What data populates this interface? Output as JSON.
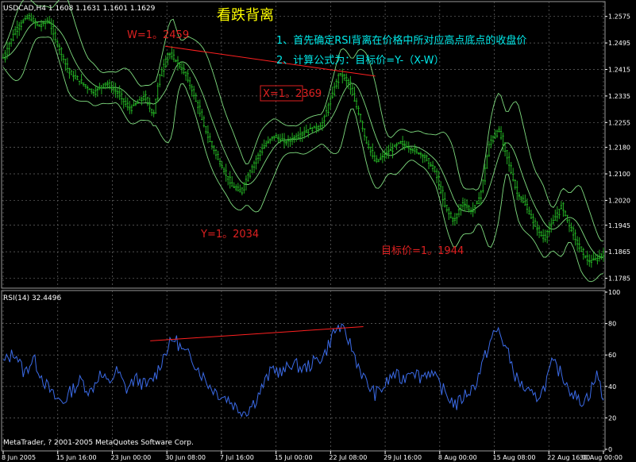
{
  "header": {
    "symbol_info": "USDCAD,H4  1.1608 1.1631 1.1601 1.1629",
    "title": "看跌背离"
  },
  "annotations": {
    "note1": "1、首先确定RSI背离在价格中所对应高点底点的收盘价",
    "note2": "2、计算公式为：目标价=Y-（X-W）",
    "w_label": "W=1。2459",
    "x_label": "X=1。2369",
    "y_label": "Y=1。2034",
    "target_label": "目标价=1。1944"
  },
  "rsi_panel": {
    "label": "RSI(14) 32.4496",
    "copyright": "MetaTrader, ? 2001-2005 MetaQuotes Software Corp."
  },
  "colors": {
    "background": "#000000",
    "grid": "#6b6b6b",
    "candles": "#22aa22",
    "bands": "#7fdc7f",
    "rsi_line": "#3b6be8",
    "trendline": "#ff2020",
    "title": "#ffff00",
    "notes": "#00e8e8",
    "labels": "#dd2020",
    "axis_text": "#ffffff"
  },
  "chart_data": {
    "type": "line",
    "panels": [
      "price",
      "rsi"
    ],
    "price_axis": {
      "ticks": [
        "1.2575",
        "1.2495",
        "1.2415",
        "1.2335",
        "1.2255",
        "1.2180",
        "1.2100",
        "1.2020",
        "1.1945",
        "1.1865",
        "1.1785"
      ],
      "ylim": [
        1.176,
        1.2615
      ]
    },
    "rsi_axis": {
      "ticks": [
        "100",
        "80",
        "60",
        "40",
        "20",
        "0"
      ],
      "ylim": [
        0,
        100
      ]
    },
    "x_ticks": [
      "8 Jun 2005",
      "15 Jun 16:00",
      "23 Jun 00:00",
      "30 Jun 08:00",
      "7 Jul 16:00",
      "15 Jul 00:00",
      "22 Jul 08:00",
      "29 Jul 16:00",
      "8 Aug 00:00",
      "15 Aug 08:00",
      "22 Aug 16:00",
      "30 Aug 00:00"
    ],
    "price_series": [
      {
        "x": 0,
        "y": 1.245
      },
      {
        "x": 0.02,
        "y": 1.2535
      },
      {
        "x": 0.04,
        "y": 1.2575
      },
      {
        "x": 0.06,
        "y": 1.2545
      },
      {
        "x": 0.075,
        "y": 1.2565
      },
      {
        "x": 0.09,
        "y": 1.249
      },
      {
        "x": 0.11,
        "y": 1.2405
      },
      {
        "x": 0.13,
        "y": 1.2375
      },
      {
        "x": 0.15,
        "y": 1.2345
      },
      {
        "x": 0.17,
        "y": 1.2375
      },
      {
        "x": 0.19,
        "y": 1.2345
      },
      {
        "x": 0.21,
        "y": 1.2295
      },
      {
        "x": 0.235,
        "y": 1.2335
      },
      {
        "x": 0.25,
        "y": 1.2275
      },
      {
        "x": 0.26,
        "y": 1.2395
      },
      {
        "x": 0.275,
        "y": 1.2465
      },
      {
        "x": 0.29,
        "y": 1.2435
      },
      {
        "x": 0.305,
        "y": 1.2395
      },
      {
        "x": 0.32,
        "y": 1.2325
      },
      {
        "x": 0.34,
        "y": 1.2215
      },
      {
        "x": 0.36,
        "y": 1.2135
      },
      {
        "x": 0.38,
        "y": 1.2065
      },
      {
        "x": 0.395,
        "y": 1.2045
      },
      {
        "x": 0.41,
        "y": 1.2105
      },
      {
        "x": 0.43,
        "y": 1.2175
      },
      {
        "x": 0.45,
        "y": 1.2215
      },
      {
        "x": 0.47,
        "y": 1.2195
      },
      {
        "x": 0.49,
        "y": 1.2215
      },
      {
        "x": 0.51,
        "y": 1.2235
      },
      {
        "x": 0.53,
        "y": 1.2245
      },
      {
        "x": 0.545,
        "y": 1.2325
      },
      {
        "x": 0.56,
        "y": 1.2405
      },
      {
        "x": 0.575,
        "y": 1.2375
      },
      {
        "x": 0.59,
        "y": 1.2295
      },
      {
        "x": 0.605,
        "y": 1.2195
      },
      {
        "x": 0.62,
        "y": 1.2135
      },
      {
        "x": 0.64,
        "y": 1.2165
      },
      {
        "x": 0.66,
        "y": 1.2195
      },
      {
        "x": 0.68,
        "y": 1.2175
      },
      {
        "x": 0.7,
        "y": 1.2155
      },
      {
        "x": 0.72,
        "y": 1.2105
      },
      {
        "x": 0.735,
        "y": 1.2005
      },
      {
        "x": 0.75,
        "y": 1.1955
      },
      {
        "x": 0.765,
        "y": 1.2015
      },
      {
        "x": 0.78,
        "y": 1.1985
      },
      {
        "x": 0.795,
        "y": 1.2035
      },
      {
        "x": 0.81,
        "y": 1.2195
      },
      {
        "x": 0.825,
        "y": 1.2235
      },
      {
        "x": 0.84,
        "y": 1.2145
      },
      {
        "x": 0.855,
        "y": 1.2045
      },
      {
        "x": 0.87,
        "y": 1.2005
      },
      {
        "x": 0.885,
        "y": 1.1945
      },
      {
        "x": 0.9,
        "y": 1.1905
      },
      {
        "x": 0.915,
        "y": 1.1955
      },
      {
        "x": 0.93,
        "y": 1.2005
      },
      {
        "x": 0.945,
        "y": 1.1935
      },
      {
        "x": 0.96,
        "y": 1.1875
      },
      {
        "x": 0.975,
        "y": 1.1835
      },
      {
        "x": 0.99,
        "y": 1.1845
      },
      {
        "x": 1.0,
        "y": 1.1865
      }
    ],
    "rsi_series": [
      {
        "x": 0,
        "y": 55
      },
      {
        "x": 0.02,
        "y": 62
      },
      {
        "x": 0.035,
        "y": 48
      },
      {
        "x": 0.05,
        "y": 58
      },
      {
        "x": 0.07,
        "y": 42
      },
      {
        "x": 0.085,
        "y": 33
      },
      {
        "x": 0.1,
        "y": 30
      },
      {
        "x": 0.115,
        "y": 38
      },
      {
        "x": 0.13,
        "y": 44
      },
      {
        "x": 0.145,
        "y": 36
      },
      {
        "x": 0.16,
        "y": 48
      },
      {
        "x": 0.175,
        "y": 42
      },
      {
        "x": 0.19,
        "y": 50
      },
      {
        "x": 0.205,
        "y": 38
      },
      {
        "x": 0.22,
        "y": 45
      },
      {
        "x": 0.24,
        "y": 40
      },
      {
        "x": 0.255,
        "y": 48
      },
      {
        "x": 0.27,
        "y": 62
      },
      {
        "x": 0.285,
        "y": 71
      },
      {
        "x": 0.3,
        "y": 62
      },
      {
        "x": 0.315,
        "y": 58
      },
      {
        "x": 0.33,
        "y": 48
      },
      {
        "x": 0.345,
        "y": 40
      },
      {
        "x": 0.36,
        "y": 35
      },
      {
        "x": 0.375,
        "y": 32
      },
      {
        "x": 0.39,
        "y": 26
      },
      {
        "x": 0.405,
        "y": 24
      },
      {
        "x": 0.42,
        "y": 31
      },
      {
        "x": 0.435,
        "y": 42
      },
      {
        "x": 0.45,
        "y": 52
      },
      {
        "x": 0.465,
        "y": 48
      },
      {
        "x": 0.48,
        "y": 55
      },
      {
        "x": 0.5,
        "y": 51
      },
      {
        "x": 0.52,
        "y": 56
      },
      {
        "x": 0.535,
        "y": 60
      },
      {
        "x": 0.55,
        "y": 74
      },
      {
        "x": 0.56,
        "y": 78
      },
      {
        "x": 0.575,
        "y": 70
      },
      {
        "x": 0.59,
        "y": 55
      },
      {
        "x": 0.605,
        "y": 42
      },
      {
        "x": 0.62,
        "y": 35
      },
      {
        "x": 0.635,
        "y": 40
      },
      {
        "x": 0.65,
        "y": 48
      },
      {
        "x": 0.665,
        "y": 44
      },
      {
        "x": 0.68,
        "y": 52
      },
      {
        "x": 0.695,
        "y": 46
      },
      {
        "x": 0.71,
        "y": 50
      },
      {
        "x": 0.725,
        "y": 42
      },
      {
        "x": 0.74,
        "y": 34
      },
      {
        "x": 0.755,
        "y": 28
      },
      {
        "x": 0.77,
        "y": 35
      },
      {
        "x": 0.785,
        "y": 40
      },
      {
        "x": 0.8,
        "y": 56
      },
      {
        "x": 0.815,
        "y": 72
      },
      {
        "x": 0.825,
        "y": 76
      },
      {
        "x": 0.84,
        "y": 62
      },
      {
        "x": 0.855,
        "y": 45
      },
      {
        "x": 0.87,
        "y": 38
      },
      {
        "x": 0.885,
        "y": 32
      },
      {
        "x": 0.9,
        "y": 38
      },
      {
        "x": 0.915,
        "y": 55
      },
      {
        "x": 0.93,
        "y": 48
      },
      {
        "x": 0.945,
        "y": 38
      },
      {
        "x": 0.96,
        "y": 30
      },
      {
        "x": 0.975,
        "y": 34
      },
      {
        "x": 0.99,
        "y": 48
      },
      {
        "x": 1.0,
        "y": 32
      }
    ],
    "trendlines": [
      {
        "panel": "price",
        "from": {
          "x": 0.27,
          "y": 1.2485
        },
        "to": {
          "x": 0.62,
          "y": 1.2395
        }
      },
      {
        "panel": "rsi",
        "from": {
          "x": 0.245,
          "y": 69
        },
        "to": {
          "x": 0.6,
          "y": 78
        }
      }
    ]
  }
}
